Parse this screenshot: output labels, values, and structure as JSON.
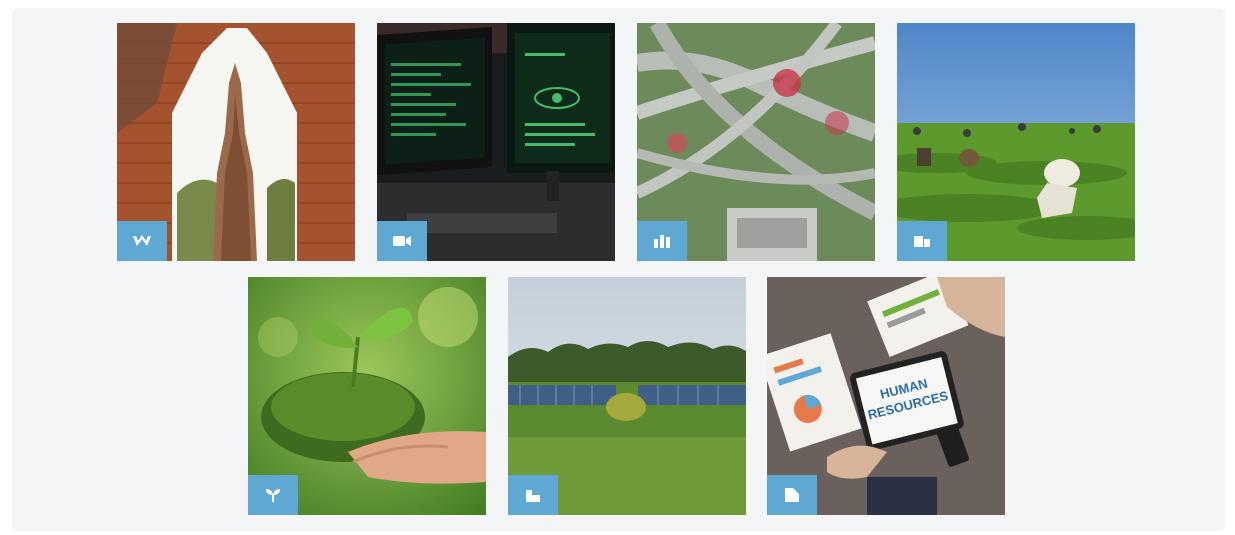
{
  "sectors": [
    {
      "id": "heritage",
      "icon": "heritage-icon"
    },
    {
      "id": "digital",
      "icon": "video-camera-icon"
    },
    {
      "id": "infrastructure",
      "icon": "infrastructure-icon"
    },
    {
      "id": "agriculture",
      "icon": "agriculture-icon"
    },
    {
      "id": "environment",
      "icon": "sprout-icon"
    },
    {
      "id": "energy",
      "icon": "energy-icon"
    },
    {
      "id": "human-resources",
      "icon": "document-icon",
      "image_text": [
        "HUMAN",
        "RESOURCES"
      ]
    }
  ],
  "colors": {
    "badge": "#5fa8d3",
    "panel": "#f4f5f7"
  }
}
